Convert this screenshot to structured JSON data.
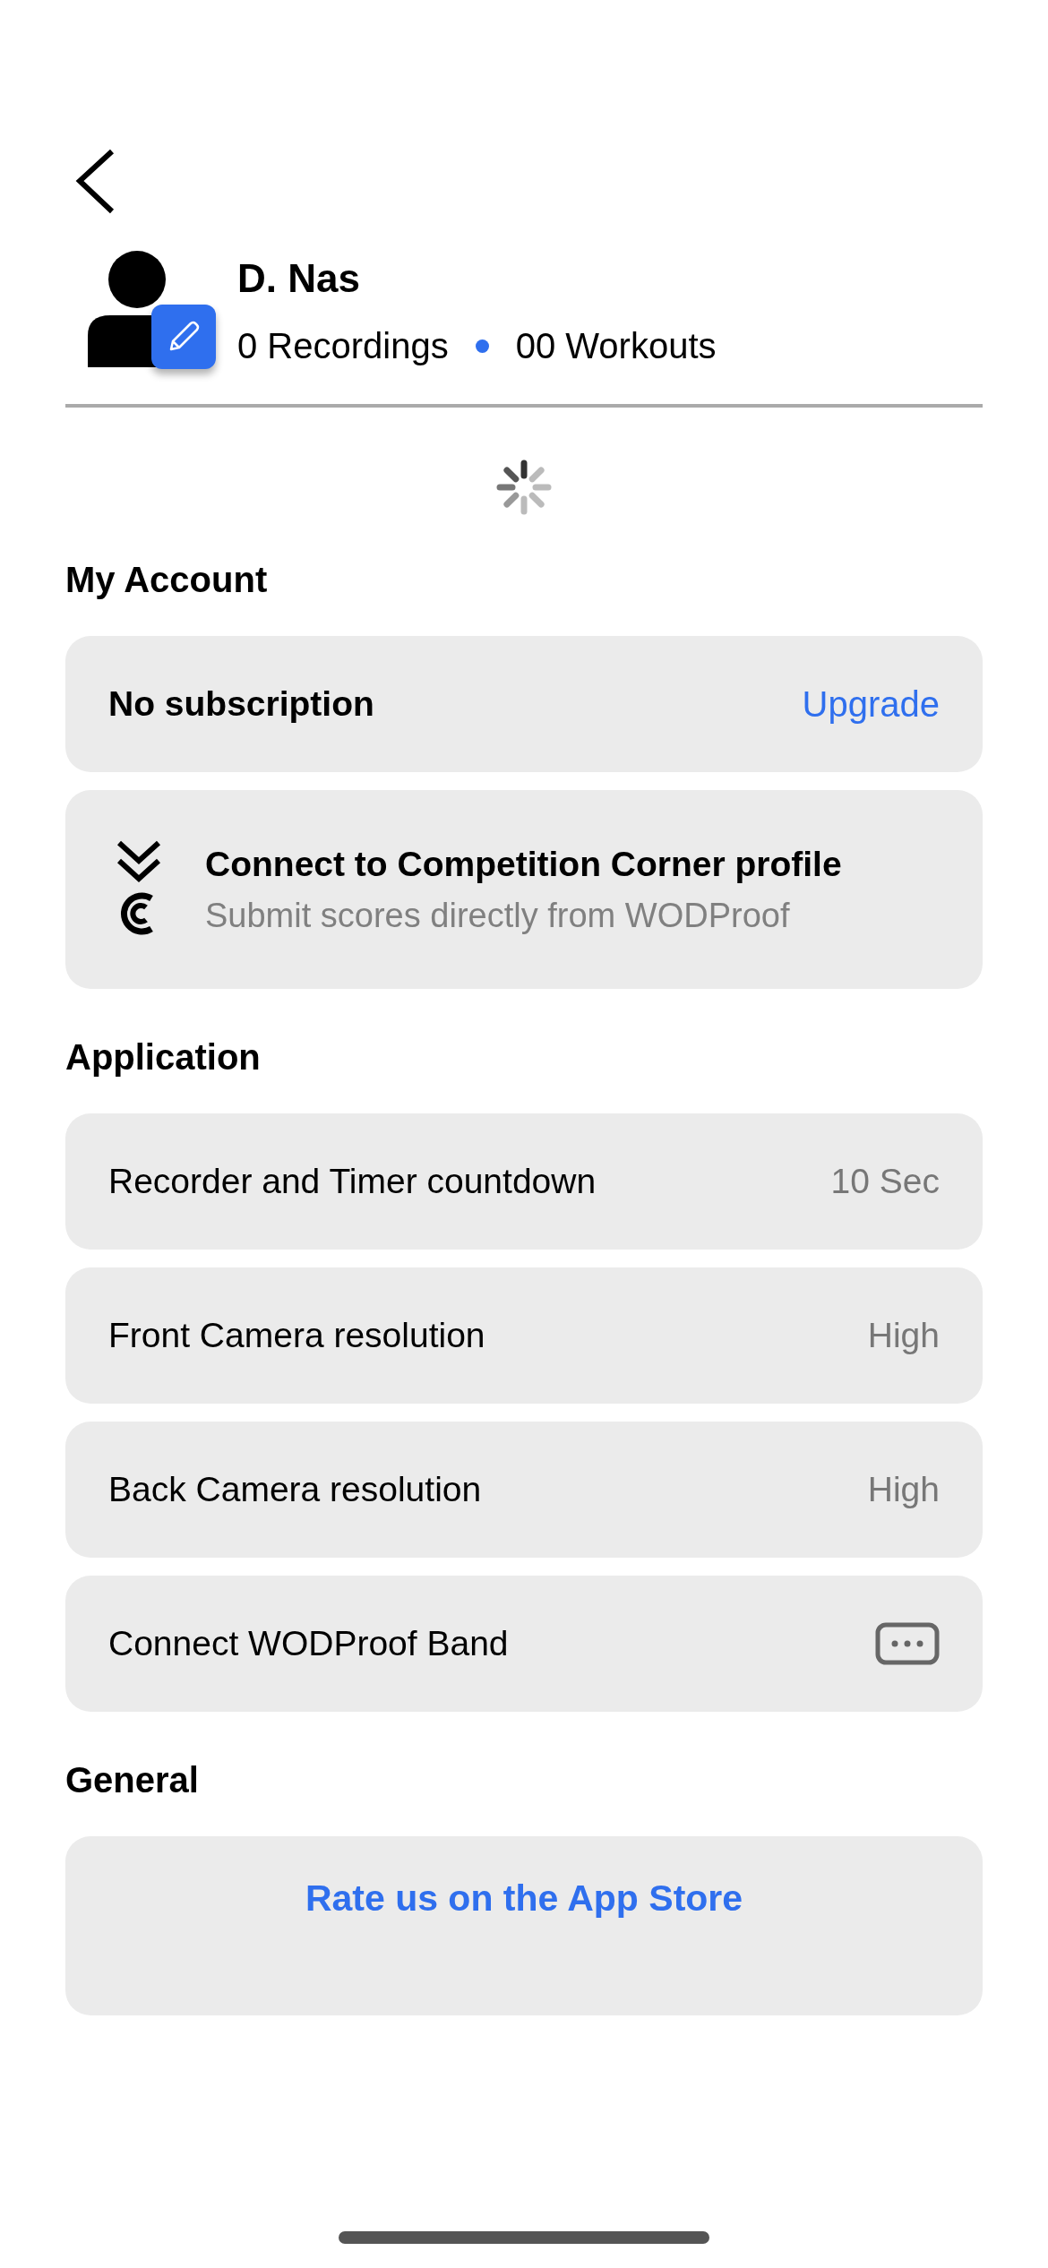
{
  "profile": {
    "name": "D. Nas",
    "recordings": "0 Recordings",
    "workouts": "00 Workouts"
  },
  "sections": [
    {
      "title": "My Account",
      "rows": [
        {
          "kind": "action",
          "label": "No subscription",
          "action": "Upgrade"
        },
        {
          "kind": "connect",
          "title": "Connect to Competition Corner profile",
          "subtitle": "Submit scores directly from WODProof"
        }
      ]
    },
    {
      "title": "Application",
      "rows": [
        {
          "kind": "value",
          "label": "Recorder and Timer countdown",
          "value": "10 Sec"
        },
        {
          "kind": "value",
          "label": "Front Camera resolution",
          "value": "High"
        },
        {
          "kind": "value",
          "label": "Back Camera resolution",
          "value": "High"
        },
        {
          "kind": "band",
          "label": "Connect WODProof Band"
        }
      ]
    },
    {
      "title": "General",
      "rows": [
        {
          "kind": "centered",
          "label": "Rate us on the App Store"
        }
      ]
    }
  ]
}
